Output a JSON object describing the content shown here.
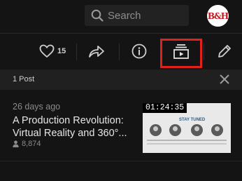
{
  "search": {
    "placeholder": "Search"
  },
  "channel": {
    "avatar_text": "B&H"
  },
  "toolbar": {
    "like_count": "15",
    "icons": [
      "heart-icon",
      "share-icon",
      "info-icon",
      "playlist-icon",
      "edit-icon"
    ],
    "highlight_color": "#e1211c"
  },
  "panel": {
    "post_count": "1 Post",
    "close_icon": "close-icon"
  },
  "post": {
    "ago": "26 days ago",
    "title_line1": "A Production Revolution:",
    "title_line2": "Virtual Reality and 360°...",
    "views": "8,874",
    "duration": "01:24:35",
    "thumb_text": "STAY TUNED"
  }
}
